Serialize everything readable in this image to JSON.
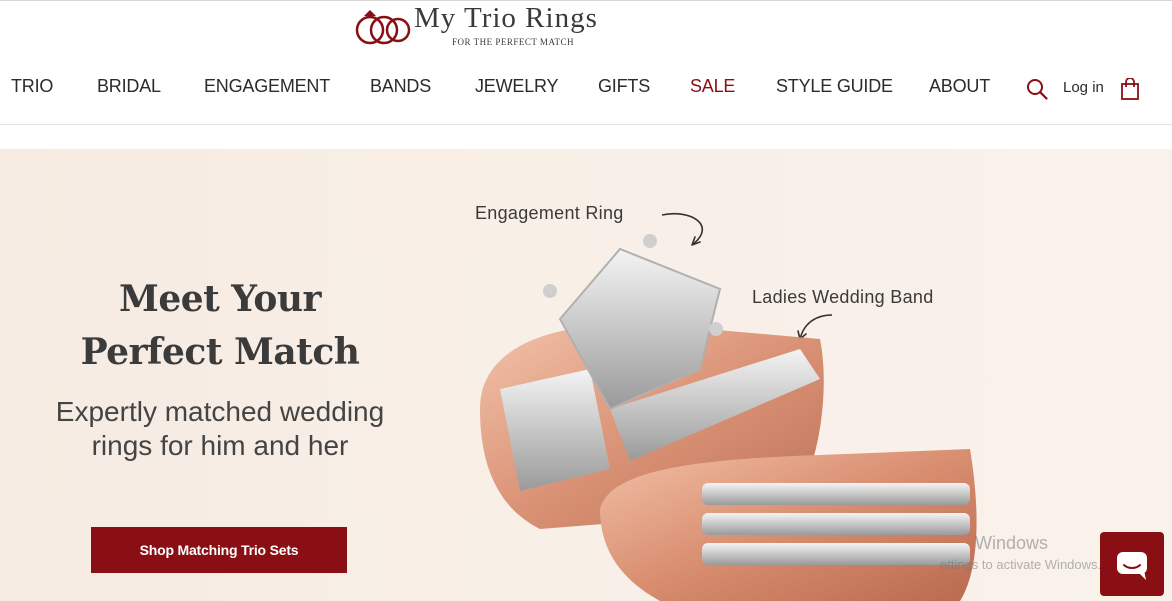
{
  "brand": {
    "name": "My Trio Rings",
    "tagline": "FOR THE  PERFECT MATCH",
    "color": "#8a0f14"
  },
  "nav": {
    "items": [
      {
        "label": "TRIO"
      },
      {
        "label": "BRIDAL"
      },
      {
        "label": "ENGAGEMENT"
      },
      {
        "label": "BANDS"
      },
      {
        "label": "JEWELRY"
      },
      {
        "label": "GIFTS"
      },
      {
        "label": "SALE"
      },
      {
        "label": "STYLE GUIDE"
      },
      {
        "label": "ABOUT"
      }
    ],
    "login_label": "Log in",
    "search_icon": "search-icon",
    "bag_icon": "shopping-bag-icon"
  },
  "hero": {
    "title_line1": "Meet Your",
    "title_line2": "Perfect Match",
    "subtitle": "Expertly matched wedding rings for him and her",
    "cta_label": "Shop Matching Trio Sets",
    "callout_engagement": "Engagement Ring",
    "callout_band": "Ladies Wedding Band"
  },
  "overlay": {
    "windows_title": "Windows",
    "windows_sub": "ettings to activate Windows."
  },
  "chat": {
    "icon": "chat-icon"
  }
}
